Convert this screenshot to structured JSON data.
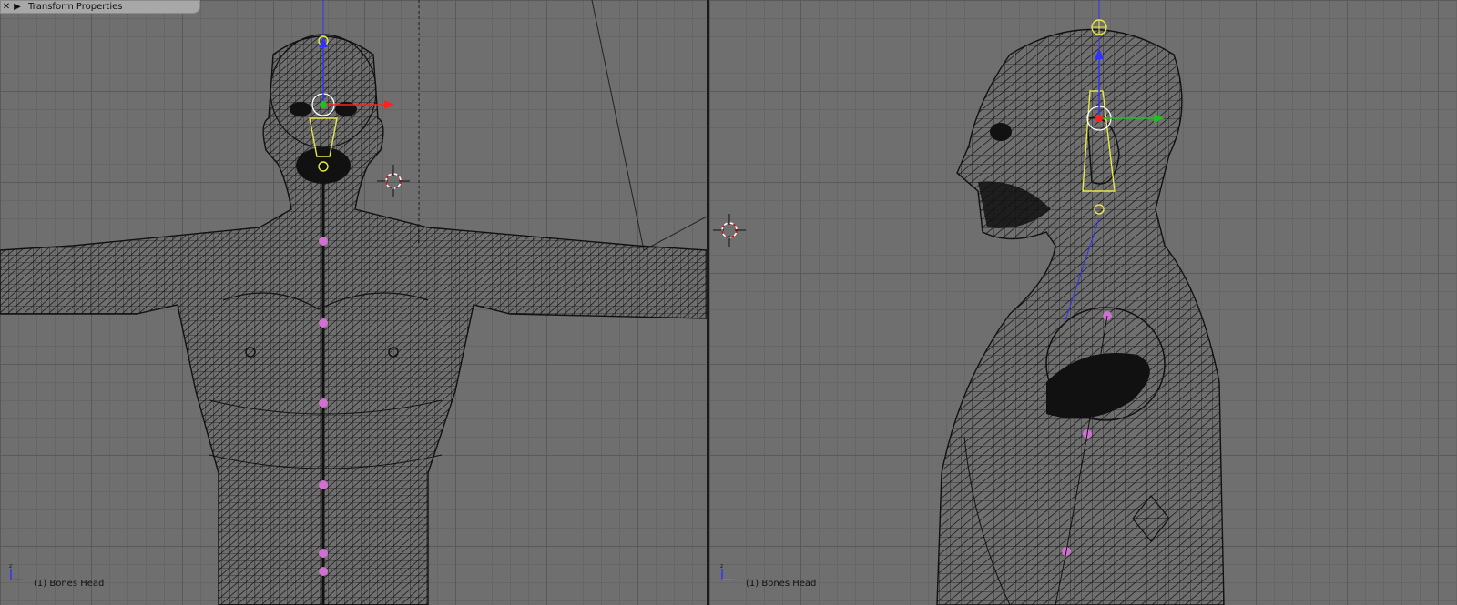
{
  "panel": {
    "title": "Transform Properties",
    "close_glyph": "✕",
    "expand_glyph": "▶"
  },
  "viewport_left": {
    "status": "(1) Bones Head",
    "axis_label": "z"
  },
  "viewport_right": {
    "status": "(1) Bones Head",
    "axis_label": "z"
  },
  "colors": {
    "background": "#6f6f6f",
    "grid_major": "#5a5a5a",
    "grid_minor": "#666666",
    "wire": "#111111",
    "bone": "#e8e84a",
    "bone_joint": "#d070d0",
    "axis_x": "#ff2020",
    "axis_y": "#20c020",
    "axis_z": "#3030ff",
    "cursor_red": "#d01010"
  }
}
